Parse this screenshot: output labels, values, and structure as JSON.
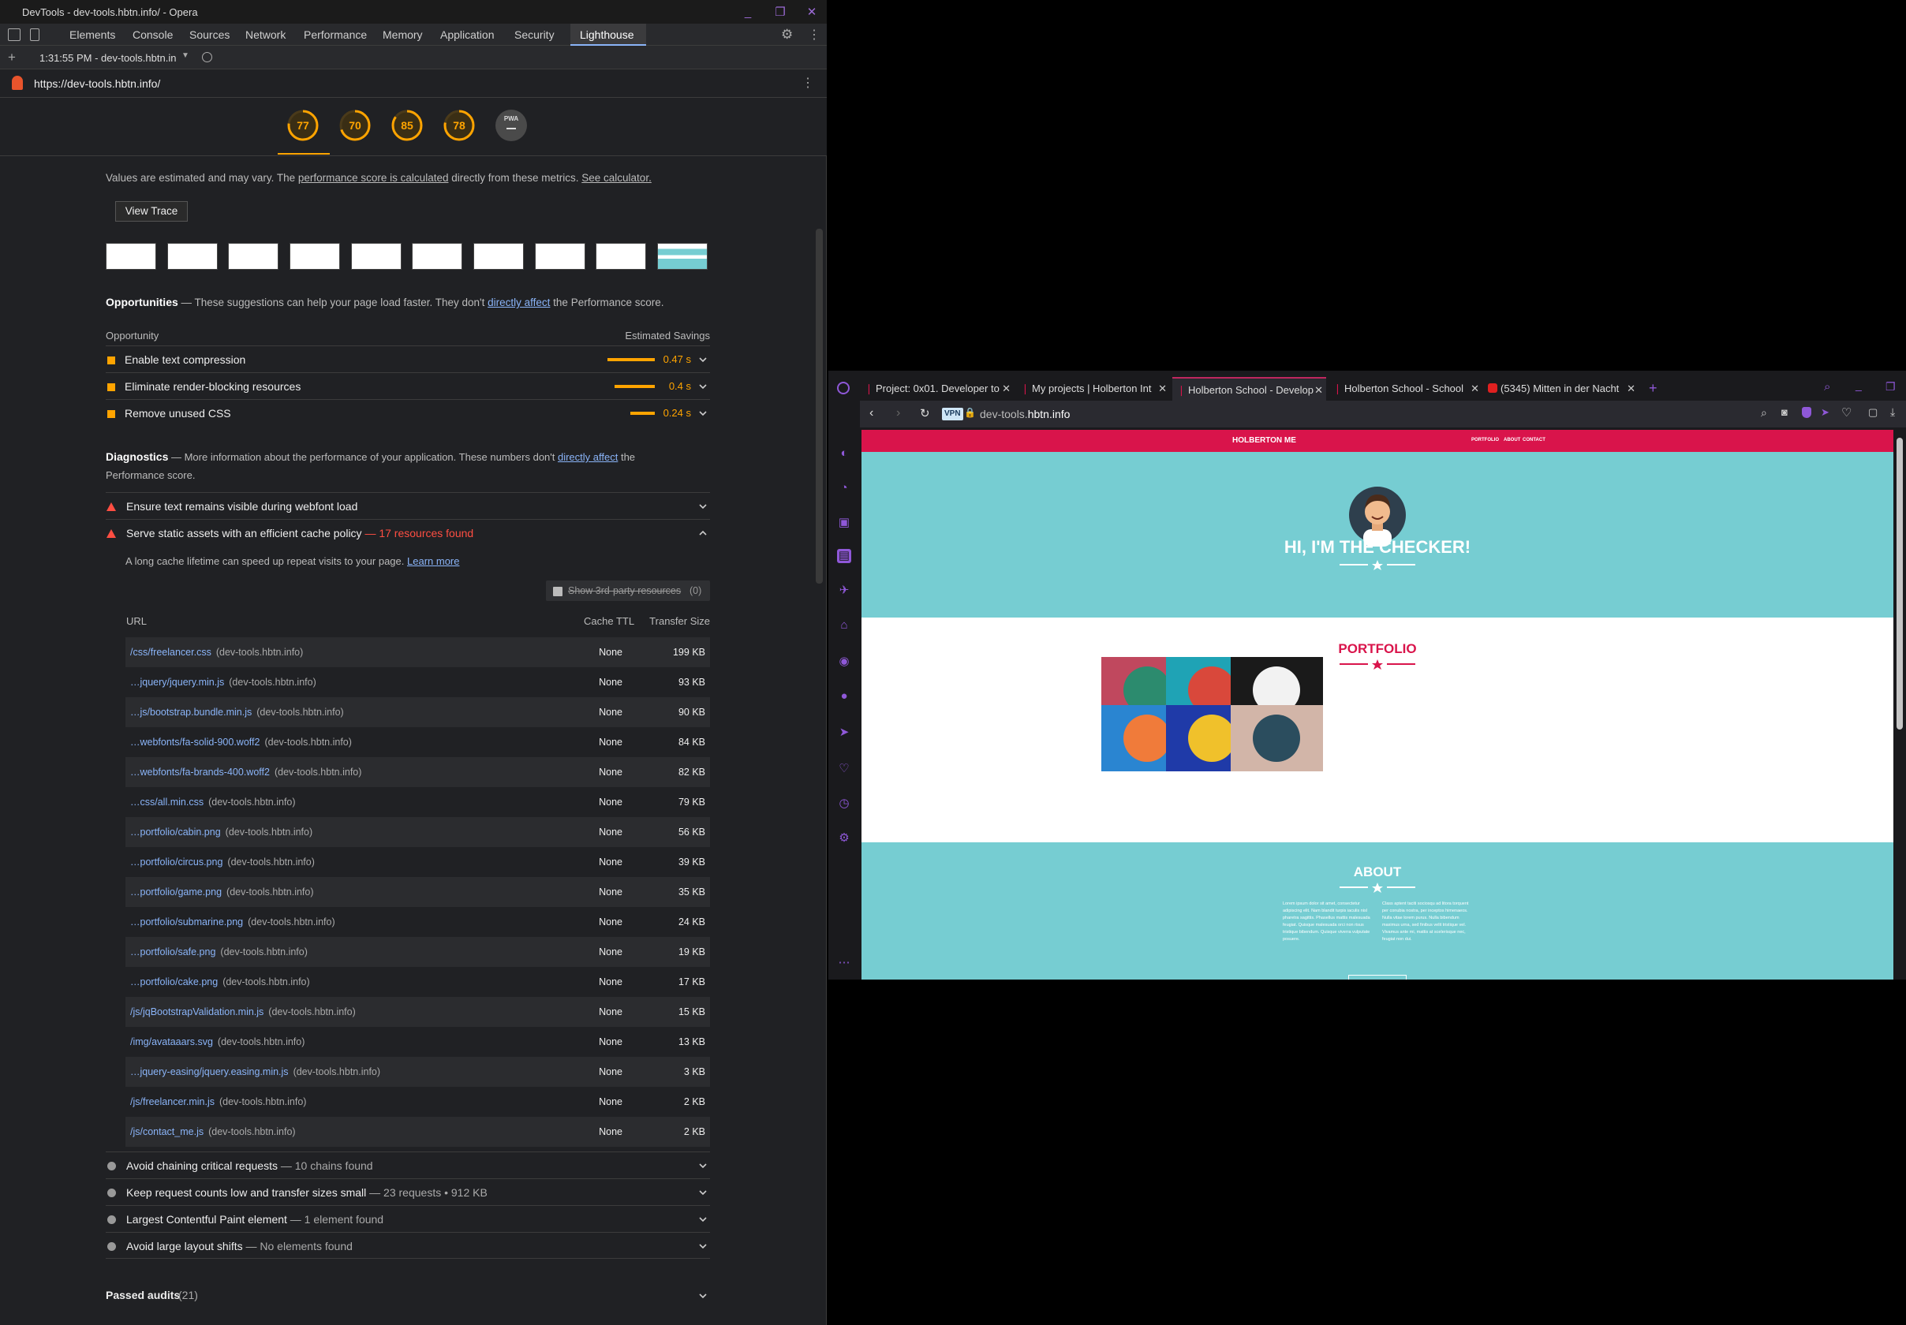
{
  "window": {
    "title": "DevTools - dev-tools.hbtn.info/ - Opera"
  },
  "devtools": {
    "tabs": [
      "Elements",
      "Console",
      "Sources",
      "Network",
      "Performance",
      "Memory",
      "Application",
      "Security",
      "Lighthouse"
    ],
    "active_tab": "Lighthouse",
    "report_time": "1:31:55 PM - dev-tools.hbtn.in",
    "url": "https://dev-tools.hbtn.info/",
    "scores": [
      {
        "value": "77",
        "color": "#ffa400",
        "progress": 0.77
      },
      {
        "value": "70",
        "color": "#ffa400",
        "progress": 0.7
      },
      {
        "value": "85",
        "color": "#ffa400",
        "progress": 0.85
      },
      {
        "value": "78",
        "color": "#ffa400",
        "progress": 0.78
      },
      {
        "value": "PWA",
        "color": "#888888",
        "progress": 0
      }
    ],
    "note_prefix": "Values are estimated and may vary. The ",
    "note_link1": "performance score is calculated",
    "note_mid": " directly from these metrics. ",
    "note_link2": "See calculator.",
    "view_trace": "View Trace",
    "opportunities": {
      "title": "Opportunities",
      "desc_prefix": " — These suggestions can help your page load faster. They don't ",
      "desc_link": "directly affect",
      "desc_suffix": " the Performance score.",
      "col_left": "Opportunity",
      "col_right": "Estimated Savings",
      "items": [
        {
          "label": "Enable text compression",
          "saving": "0.47 s",
          "fraction": 1.0
        },
        {
          "label": "Eliminate render-blocking resources",
          "saving": "0.4 s",
          "fraction": 0.85
        },
        {
          "label": "Remove unused CSS",
          "saving": "0.24 s",
          "fraction": 0.51
        }
      ]
    },
    "diagnostics": {
      "title": "Diagnostics",
      "desc_prefix": " — More information about the performance of your application. These numbers don't ",
      "desc_link": "directly affect",
      "desc_suffix": " the",
      "desc_line2": "Performance score.",
      "warn1": "Ensure text remains visible during webfont load",
      "warn2": "Serve static assets with an efficient cache policy",
      "warn2_count": " — 17 resources found",
      "cache_desc": "A long cache lifetime can speed up repeat visits to your page. ",
      "cache_link": "Learn more",
      "third_party": "Show 3rd-party resources",
      "third_party_count": "(0)",
      "cols": {
        "url": "URL",
        "ttl": "Cache TTL",
        "size": "Transfer Size"
      },
      "rows": [
        {
          "url": "/css/freelancer.css",
          "host": "(dev-tools.hbtn.info)",
          "ttl": "None",
          "size": "199 KB"
        },
        {
          "url": "…jquery/jquery.min.js",
          "host": "(dev-tools.hbtn.info)",
          "ttl": "None",
          "size": "93 KB"
        },
        {
          "url": "…js/bootstrap.bundle.min.js",
          "host": "(dev-tools.hbtn.info)",
          "ttl": "None",
          "size": "90 KB"
        },
        {
          "url": "…webfonts/fa-solid-900.woff2",
          "host": "(dev-tools.hbtn.info)",
          "ttl": "None",
          "size": "84 KB"
        },
        {
          "url": "…webfonts/fa-brands-400.woff2",
          "host": "(dev-tools.hbtn.info)",
          "ttl": "None",
          "size": "82 KB"
        },
        {
          "url": "…css/all.min.css",
          "host": "(dev-tools.hbtn.info)",
          "ttl": "None",
          "size": "79 KB"
        },
        {
          "url": "…portfolio/cabin.png",
          "host": "(dev-tools.hbtn.info)",
          "ttl": "None",
          "size": "56 KB"
        },
        {
          "url": "…portfolio/circus.png",
          "host": "(dev-tools.hbtn.info)",
          "ttl": "None",
          "size": "39 KB"
        },
        {
          "url": "…portfolio/game.png",
          "host": "(dev-tools.hbtn.info)",
          "ttl": "None",
          "size": "35 KB"
        },
        {
          "url": "…portfolio/submarine.png",
          "host": "(dev-tools.hbtn.info)",
          "ttl": "None",
          "size": "24 KB"
        },
        {
          "url": "…portfolio/safe.png",
          "host": "(dev-tools.hbtn.info)",
          "ttl": "None",
          "size": "19 KB"
        },
        {
          "url": "…portfolio/cake.png",
          "host": "(dev-tools.hbtn.info)",
          "ttl": "None",
          "size": "17 KB"
        },
        {
          "url": "/js/jqBootstrapValidation.min.js",
          "host": "(dev-tools.hbtn.info)",
          "ttl": "None",
          "size": "15 KB"
        },
        {
          "url": "/img/avataaars.svg",
          "host": "(dev-tools.hbtn.info)",
          "ttl": "None",
          "size": "13 KB"
        },
        {
          "url": "…jquery-easing/jquery.easing.min.js",
          "host": "(dev-tools.hbtn.info)",
          "ttl": "None",
          "size": "3 KB"
        },
        {
          "url": "/js/freelancer.min.js",
          "host": "(dev-tools.hbtn.info)",
          "ttl": "None",
          "size": "2 KB"
        },
        {
          "url": "/js/contact_me.js",
          "host": "(dev-tools.hbtn.info)",
          "ttl": "None",
          "size": "2 KB"
        }
      ],
      "info": [
        {
          "label": "Avoid chaining critical requests",
          "detail": " — 10 chains found"
        },
        {
          "label": "Keep request counts low and transfer sizes small",
          "detail": " — 23 requests • 912 KB"
        },
        {
          "label": "Largest Contentful Paint element",
          "detail": " — 1 element found"
        },
        {
          "label": "Avoid large layout shifts",
          "detail": " — No elements found"
        }
      ]
    },
    "passed": {
      "label": "Passed audits",
      "count": "(21)"
    }
  },
  "browser": {
    "tabs": [
      {
        "label": "Project: 0x01. Developer to"
      },
      {
        "label": "My projects | Holberton Int"
      },
      {
        "label": "Holberton School - Develop"
      },
      {
        "label": "Holberton School - School"
      },
      {
        "label": "(5345) Mitten in der Nacht"
      }
    ],
    "active_tab": 2,
    "vpn": "VPN",
    "address_prefix": "dev-tools.",
    "address_domain": "hbtn.info",
    "site": {
      "brand": "HOLBERTON ME",
      "nav": [
        "PORTFOLIO",
        "ABOUT",
        "CONTACT"
      ],
      "hero_title": "HI, I'M THE CHECKER!",
      "portfolio_title": "PORTFOLIO",
      "portfolio_tiles": [
        {
          "name": "cabin",
          "bg": "#c0485e",
          "circle": "#2c8b6e"
        },
        {
          "name": "cake",
          "bg": "#1fa3b5",
          "circle": "#d9483b"
        },
        {
          "name": "circus",
          "bg": "#1a1a1a",
          "circle": "#f2f2f2"
        },
        {
          "name": "game",
          "bg": "#2a85d1",
          "circle": "#f07b3a"
        },
        {
          "name": "safe",
          "bg": "#1f3aa8",
          "circle": "#f0c12b"
        },
        {
          "name": "submarine",
          "bg": "#d2b5a8",
          "circle": "#2b4d5e"
        }
      ],
      "about_title": "ABOUT",
      "about_col1": "Lorem ipsum dolor sit amet, consectetur adipiscing elit. Nam blandit turpis iaculis nisl pharetra sagittis. Phasellus mattis malesuada feugiat. Quisque malesuada orci non risus tristique bibendum. Quisque viverra vulputate posuere.",
      "about_col2": "Class aptent taciti sociosqu ad litora torquent per conubia nostra, per inceptos himenaeos. Nulla vitae lorem purus. Nulla bibendum maximus urna, sed finibus velit tristique vel. Vivamus ante mi, mattis at scelerisque nec, feugiat non dui."
    }
  }
}
